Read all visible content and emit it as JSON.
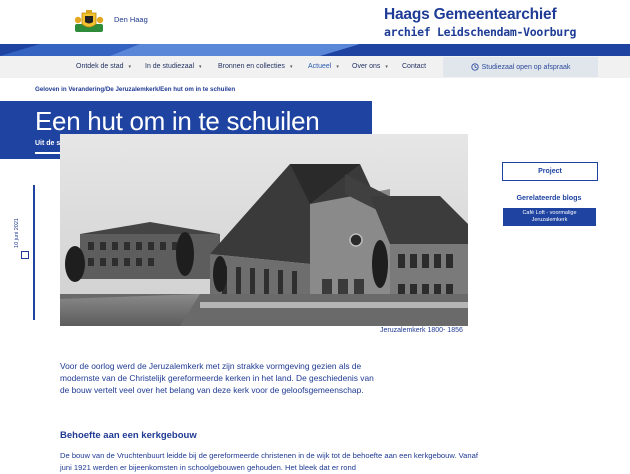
{
  "header": {
    "logo_text": "Den Haag",
    "brand_title": "Haags Gemeentearchief",
    "brand_subtitle": "archief Leidschendam-Voorburg"
  },
  "nav": {
    "items": [
      {
        "label": "Ontdek de stad",
        "caret": "▾"
      },
      {
        "label": "In de studiezaal",
        "caret": "▾"
      },
      {
        "label": "Bronnen en collecties",
        "caret": "▾"
      },
      {
        "label": "Actueel",
        "caret": "▾"
      },
      {
        "label": "Over ons",
        "caret": "▾"
      },
      {
        "label": "Contact"
      }
    ],
    "appointment": "Studiezaal open op afspraak"
  },
  "breadcrumb": "Geloven in Verandering/De Jeruzalemkerk/Een hut om in te schuilen",
  "article": {
    "title": "Een hut om in te schuilen",
    "subtitle": "Uit de serie 'Geloven in verandering'",
    "date": "10 juni 2021",
    "image_caption": "Jeruzalemkerk 1800- 1856",
    "intro": "Voor de oorlog werd de Jeruzalemkerk met zijn strakke vormgeving gezien als de modernste van de Christelijk gereformeerde kerken in het land. De geschiedenis van de bouw vertelt veel over het belang van deze kerk voor de geloofsgemeenschap.",
    "section_heading": "Behoefte aan een kerkgebouw",
    "section_text": "De bouw van de Vruchtenbuurt leidde bij de gereformeerde christenen in de wijk tot de behoefte aan een kerkgebouw. Vanaf juni 1921 werden er bijeenkomsten in schoolgebouwen gehouden. Het bleek dat er rond"
  },
  "sidebar": {
    "project_button": "Project",
    "related_heading": "Gerelateerde blogs",
    "blog_card_line1": "Café Loft - voormalige",
    "blog_card_line2": "Jeruzalemkerk"
  },
  "colors": {
    "primary": "#1e43a0",
    "nav_bg": "#f1f1f1",
    "active_nav": "#2c5cb0",
    "text": "#1f3a93"
  },
  "icons": {
    "logo": "den-haag-coat-of-arms",
    "appointment": "clock-icon",
    "date": "calendar-icon",
    "dropdown": "chevron-down-icon"
  }
}
